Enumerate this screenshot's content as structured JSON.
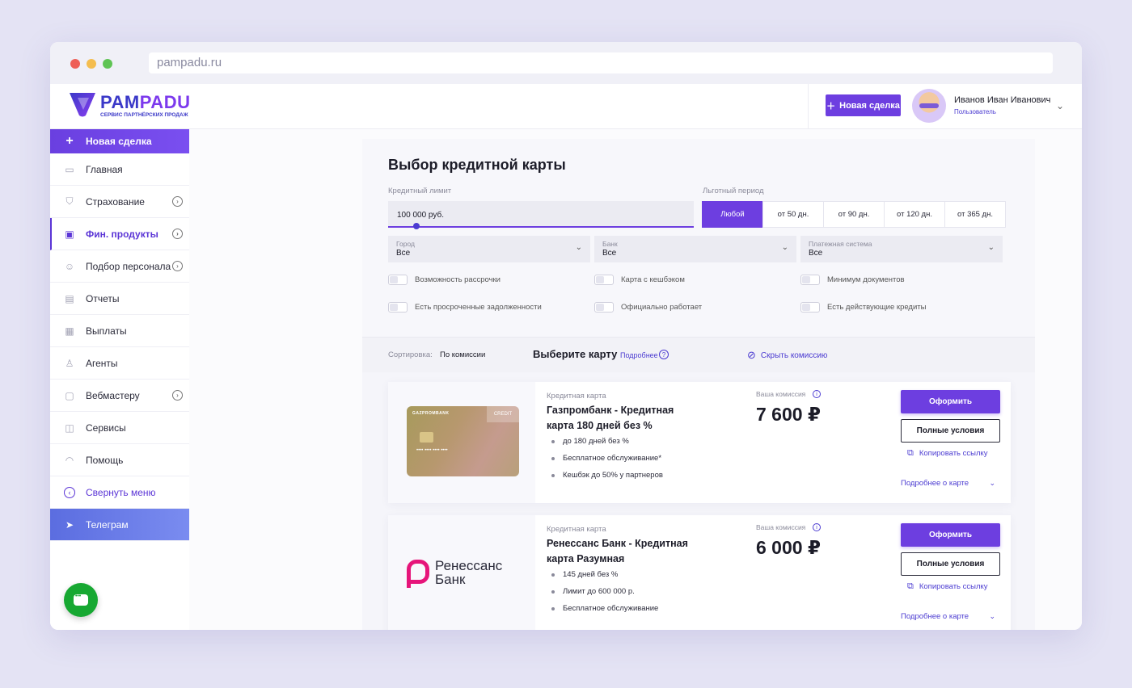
{
  "browser": {
    "url": "pampadu.ru"
  },
  "header": {
    "logo_main": "PAM",
    "logo_accent": "PADU",
    "logo_sub": "СЕРВИС ПАРТНЁРСКИХ ПРОДАЖ",
    "new_deal": "Новая сделка",
    "user_name": "Иванов Иван Иванович",
    "user_role": "Пользователь"
  },
  "sidebar": {
    "new_deal": "Новая сделка",
    "items": [
      {
        "label": "Главная",
        "icon": "monitor-icon"
      },
      {
        "label": "Страхование",
        "icon": "shield-icon"
      },
      {
        "label": "Фин. продукты",
        "icon": "wallet-icon"
      },
      {
        "label": "Подбор персонала",
        "icon": "person-icon"
      },
      {
        "label": "Отчеты",
        "icon": "report-icon"
      },
      {
        "label": "Выплаты",
        "icon": "payments-icon"
      },
      {
        "label": "Агенты",
        "icon": "agent-icon"
      },
      {
        "label": "Вебмастеру",
        "icon": "webmaster-icon"
      },
      {
        "label": "Сервисы",
        "icon": "briefcase-icon"
      },
      {
        "label": "Помощь",
        "icon": "help-icon"
      }
    ],
    "collapse": "Свернуть меню",
    "telegram": "Телеграм"
  },
  "filters": {
    "title": "Выбор кредитной карты",
    "limit_label": "Кредитный лимит",
    "limit_value": "100 000 руб.",
    "period_label": "Льготный период",
    "periods": [
      "Любой",
      "от 50 дн.",
      "от 90 дн.",
      "от 120 дн.",
      "от 365 дн."
    ],
    "selected_period": "Любой",
    "city_label": "Город",
    "city_value": "Все",
    "bank_label": "Банк",
    "bank_value": "Все",
    "payment_label": "Платежная система",
    "payment_value": "Все",
    "toggles": [
      "Возможность рассрочки",
      "Карта с кешбэком",
      "Минимум документов",
      "Есть просроченные задолженности",
      "Официально работает",
      "Есть действующие кредиты"
    ]
  },
  "sort": {
    "label": "Сортировка:",
    "value": "По комиссии",
    "choose": "Выберите карту",
    "more": "Подробнее",
    "hide_commission": "Скрыть комиссию"
  },
  "cards": [
    {
      "type": "Кредитная карта",
      "name": "Газпромбанк - Кредитная карта 180 дней без %",
      "features": [
        "до 180 дней без %",
        "Бесплатное обслуживание*",
        "Кешбэк до 50% у партнеров"
      ],
      "commission_label": "Ваша комиссия",
      "commission": "7 600 ₽",
      "apply": "Оформить",
      "conditions": "Полные условия",
      "copy_link": "Копировать ссылку",
      "details": "Подробнее о карте",
      "card_bank_text": "GAZPROMBANK",
      "card_badge": "CREDIT"
    },
    {
      "type": "Кредитная карта",
      "name": "Ренессанс Банк - Кредитная карта Разумная",
      "features": [
        "145 дней без %",
        "Лимит до 600 000 р.",
        "Бесплатное обслуживание"
      ],
      "commission_label": "Ваша комиссия",
      "commission": "6 000 ₽",
      "apply": "Оформить",
      "conditions": "Полные условия",
      "copy_link": "Копировать ссылку",
      "details": "Подробнее о карте",
      "logo_line1": "Ренессанс",
      "logo_line2": "Банк"
    }
  ],
  "colors": {
    "accent": "#6d3ee0",
    "link": "#4b3bd1",
    "chat": "#17a832",
    "renaissance": "#e6157a"
  }
}
